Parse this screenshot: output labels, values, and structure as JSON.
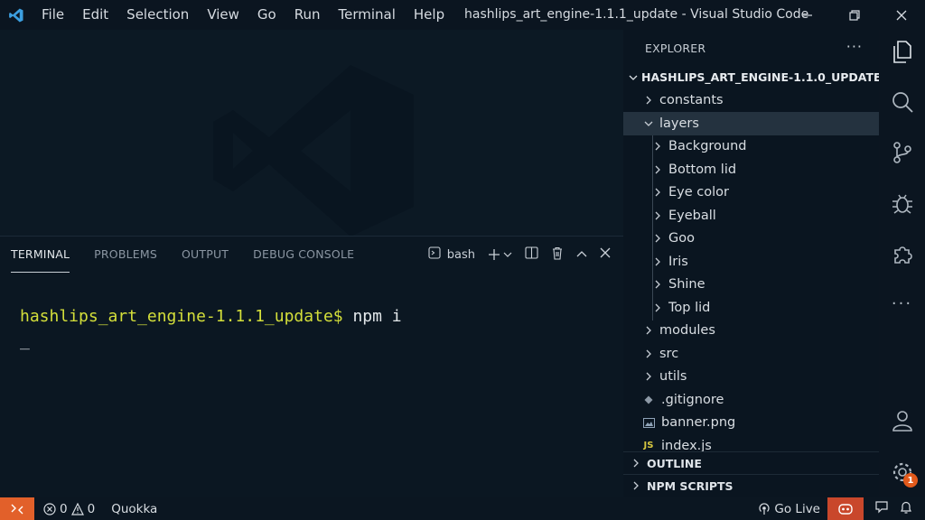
{
  "window": {
    "title": "hashlips_art_engine-1.1.1_update - Visual Studio Code",
    "menu": [
      "File",
      "Edit",
      "Selection",
      "View",
      "Go",
      "Run",
      "Terminal",
      "Help"
    ]
  },
  "panel": {
    "tabs": [
      "TERMINAL",
      "PROBLEMS",
      "OUTPUT",
      "DEBUG CONSOLE"
    ],
    "active_tab": "TERMINAL",
    "shell": "bash"
  },
  "terminal": {
    "prompt_path": "hashlips_art_engine-1.1.1_update$",
    "command": " npm i",
    "cursor": "_"
  },
  "explorer": {
    "header": "EXPLORER",
    "more": "···",
    "root": "HASHLIPS_ART_ENGINE-1.1.0_UPDATE",
    "items": [
      {
        "label": "constants",
        "kind": "folder",
        "level": 1,
        "open": false
      },
      {
        "label": "layers",
        "kind": "folder",
        "level": 1,
        "open": true,
        "selected": true
      },
      {
        "label": "Background",
        "kind": "folder",
        "level": 2,
        "open": false
      },
      {
        "label": "Bottom lid",
        "kind": "folder",
        "level": 2,
        "open": false
      },
      {
        "label": "Eye color",
        "kind": "folder",
        "level": 2,
        "open": false
      },
      {
        "label": "Eyeball",
        "kind": "folder",
        "level": 2,
        "open": false
      },
      {
        "label": "Goo",
        "kind": "folder",
        "level": 2,
        "open": false
      },
      {
        "label": "Iris",
        "kind": "folder",
        "level": 2,
        "open": false
      },
      {
        "label": "Shine",
        "kind": "folder",
        "level": 2,
        "open": false
      },
      {
        "label": "Top lid",
        "kind": "folder",
        "level": 2,
        "open": false
      },
      {
        "label": "modules",
        "kind": "folder",
        "level": 1,
        "open": false
      },
      {
        "label": "src",
        "kind": "folder",
        "level": 1,
        "open": false
      },
      {
        "label": "utils",
        "kind": "folder",
        "level": 1,
        "open": false
      },
      {
        "label": ".gitignore",
        "kind": "file",
        "icon": "diamond-icon",
        "level": 1
      },
      {
        "label": "banner.png",
        "kind": "file",
        "icon": "image-icon",
        "level": 1
      },
      {
        "label": "index.js",
        "kind": "file",
        "icon": "js-icon",
        "iconText": "JS",
        "level": 1
      }
    ],
    "sections": [
      "OUTLINE",
      "NPM SCRIPTS"
    ]
  },
  "status": {
    "errors": "0",
    "warnings": "0",
    "quokka": "Quokka",
    "golive": "Go Live",
    "settings_badge": "1"
  },
  "colors": {
    "accent_orange": "#e2602a",
    "prompt_yellow": "#d4df3a",
    "background": "#0d1a26"
  }
}
